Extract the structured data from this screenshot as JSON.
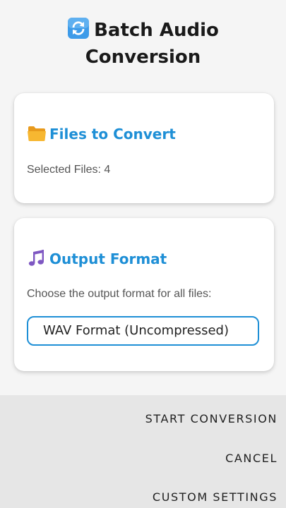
{
  "header": {
    "title_line1": "Batch Audio",
    "title_line2": "Conversion",
    "icon": "refresh-arrows-icon"
  },
  "files_card": {
    "heading": "Files to Convert",
    "icon": "folder-icon",
    "selected_text": "Selected Files: 4"
  },
  "format_card": {
    "heading": "Output Format",
    "icon": "music-notes-icon",
    "description": "Choose the output format for all files:",
    "selected_format": "WAV Format (Uncompressed)"
  },
  "actions": {
    "start_label": "START CONVERSION",
    "cancel_label": "CANCEL",
    "custom_label": "CUSTOM SETTINGS"
  },
  "colors": {
    "accent": "#1e8fd6",
    "background": "#f5f5f5",
    "footer": "#e6e6e6"
  }
}
